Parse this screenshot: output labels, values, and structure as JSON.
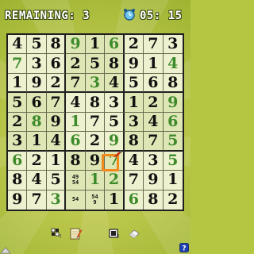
{
  "hud": {
    "remaining": "REMAINING: 3",
    "timer": "05: 15"
  },
  "board": {
    "rows": [
      [
        "4",
        "5",
        "8",
        "9",
        "1",
        "6",
        "2",
        "7",
        "3"
      ],
      [
        "7",
        "3",
        "6",
        "2",
        "5",
        "8",
        "9",
        "1",
        "4"
      ],
      [
        "1",
        "9",
        "2",
        "7",
        "3",
        "4",
        "5",
        "6",
        "8"
      ],
      [
        "5",
        "6",
        "7",
        "4",
        "8",
        "3",
        "1",
        "2",
        "9"
      ],
      [
        "2",
        "8",
        "9",
        "1",
        "7",
        "5",
        "3",
        "4",
        "6"
      ],
      [
        "3",
        "1",
        "4",
        "6",
        "2",
        "9",
        "8",
        "7",
        "5"
      ],
      [
        "6",
        "2",
        "1",
        "8",
        "9",
        "7",
        "4",
        "3",
        "5"
      ],
      [
        "8",
        "4",
        "5",
        "49\n54",
        "1",
        "2",
        "7",
        "9",
        "1"
      ],
      [
        "9",
        "7",
        "3",
        "54",
        "54\n9",
        "1",
        "6",
        "8",
        "2"
      ]
    ],
    "kinds": [
      [
        "f",
        "f",
        "f",
        "u",
        "f",
        "u",
        "f",
        "f",
        "f"
      ],
      [
        "u",
        "f",
        "f",
        "f",
        "f",
        "f",
        "f",
        "f",
        "u"
      ],
      [
        "f",
        "f",
        "f",
        "f",
        "u",
        "f",
        "f",
        "f",
        "f"
      ],
      [
        "f",
        "f",
        "f",
        "f",
        "f",
        "f",
        "f",
        "f",
        "u"
      ],
      [
        "f",
        "u",
        "f",
        "u",
        "f",
        "f",
        "f",
        "f",
        "u"
      ],
      [
        "f",
        "f",
        "f",
        "u",
        "f",
        "u",
        "f",
        "f",
        "u"
      ],
      [
        "u",
        "f",
        "f",
        "f",
        "f",
        "u",
        "f",
        "f",
        "u"
      ],
      [
        "f",
        "f",
        "f",
        "n",
        "u",
        "u",
        "f",
        "f",
        "f"
      ],
      [
        "f",
        "f",
        "u",
        "n",
        "n",
        "f",
        "u",
        "f",
        "f"
      ]
    ],
    "cursor": {
      "row": 7,
      "col": 6
    }
  },
  "toolbar": {
    "icons": [
      "grid-toggle-icon",
      "pencil-notes-icon",
      "dots-icon",
      "eraser-icon"
    ]
  },
  "colors": {
    "background": "#b5c742",
    "fixed_digit": "#111111",
    "user_digit": "#3c8a2a",
    "cursor": "#f08a1e"
  }
}
